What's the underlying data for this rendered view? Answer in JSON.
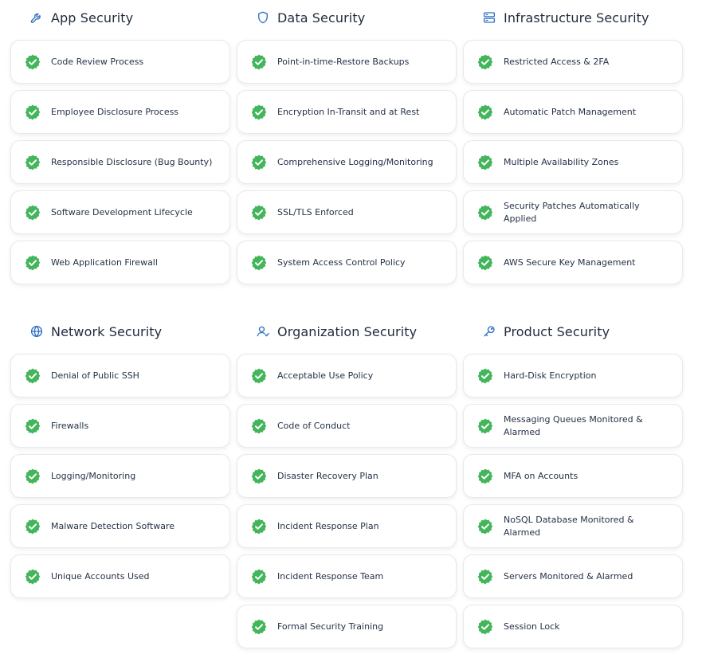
{
  "colors": {
    "accent": "#2f6fc0",
    "check": "#43b55a",
    "title": "#1f2b3d",
    "text": "#253247",
    "card_border": "#e6e9ee"
  },
  "sections": [
    {
      "title": "App Security",
      "icon": "wrench-icon",
      "items": [
        "Code Review Process",
        "Employee Disclosure Process",
        "Responsible Disclosure (Bug Bounty)",
        "Software Development Lifecycle",
        "Web Application Firewall"
      ]
    },
    {
      "title": "Data Security",
      "icon": "shield-icon",
      "items": [
        "Point-in-time-Restore Backups",
        "Encryption In-Transit and at Rest",
        "Comprehensive Logging/Monitoring",
        "SSL/TLS Enforced",
        "System Access Control Policy"
      ]
    },
    {
      "title": "Infrastructure Security",
      "icon": "server-icon",
      "items": [
        "Restricted Access & 2FA",
        "Automatic Patch Management",
        "Multiple Availability Zones",
        "Security Patches Automatically Applied",
        "AWS Secure Key Management"
      ]
    },
    {
      "title": "Network Security",
      "icon": "globe-icon",
      "items": [
        "Denial of Public SSH",
        "Firewalls",
        "Logging/Monitoring",
        "Malware Detection Software",
        "Unique Accounts Used"
      ]
    },
    {
      "title": "Organization Security",
      "icon": "user-icon",
      "items": [
        "Acceptable Use Policy",
        "Code of Conduct",
        "Disaster Recovery Plan",
        "Incident Response Plan",
        "Incident Response Team",
        "Formal Security Training"
      ]
    },
    {
      "title": "Product Security",
      "icon": "key-icon",
      "items": [
        "Hard-Disk Encryption",
        "Messaging Queues Monitored & Alarmed",
        "MFA on Accounts",
        "NoSQL Database Monitored & Alarmed",
        "Servers Monitored & Alarmed",
        "Session Lock"
      ]
    }
  ]
}
